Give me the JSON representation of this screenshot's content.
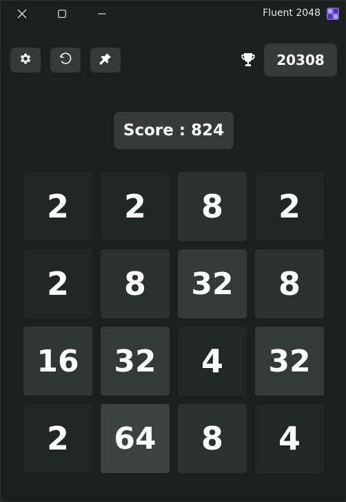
{
  "window": {
    "title": "Fluent 2048",
    "caption_buttons": [
      "close-icon",
      "maximize-icon",
      "minimize-icon"
    ]
  },
  "toolbar": {
    "buttons": [
      {
        "name": "settings",
        "icon": "gear-icon"
      },
      {
        "name": "undo",
        "icon": "undo-icon"
      },
      {
        "name": "pin",
        "icon": "pin-icon"
      }
    ],
    "best_icon": "trophy-icon",
    "best_score": "20308"
  },
  "score": {
    "label": "Score",
    "separator": " : ",
    "value": "824"
  },
  "board": {
    "rows": [
      [
        "2",
        "2",
        "8",
        "2"
      ],
      [
        "2",
        "8",
        "32",
        "8"
      ],
      [
        "16",
        "32",
        "4",
        "32"
      ],
      [
        "2",
        "64",
        "8",
        "4"
      ]
    ]
  },
  "colors": {
    "background": "#1b201f",
    "panel": "#353b39",
    "text": "#ffffff",
    "app_icon": "#7a5fd6"
  }
}
